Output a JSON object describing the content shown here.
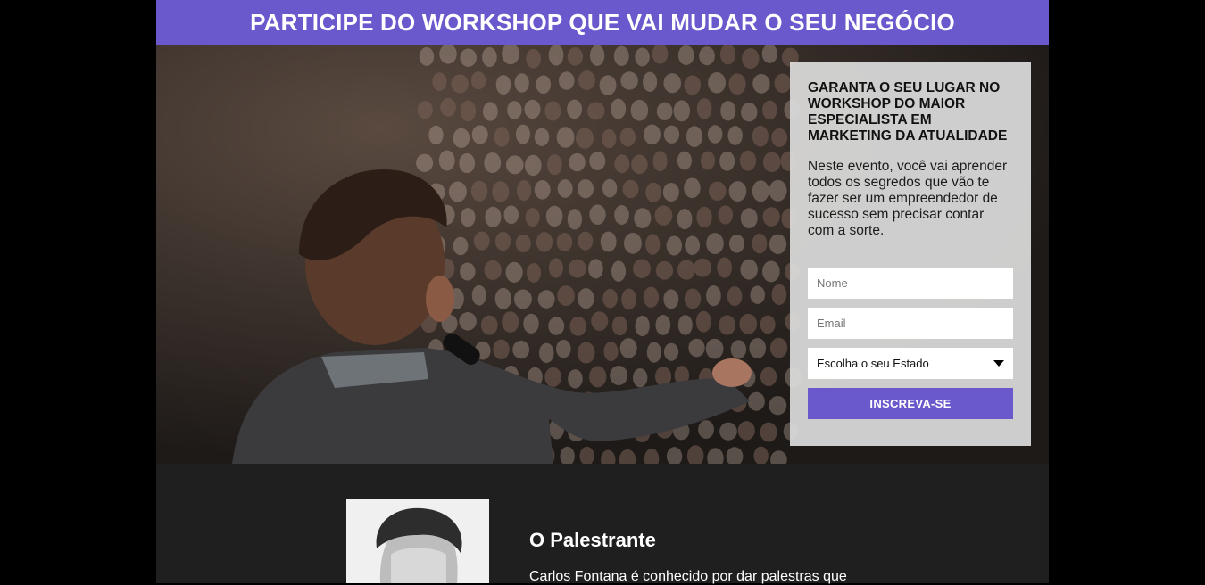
{
  "banner": {
    "title": "PARTICIPE DO WORKSHOP QUE VAI MUDAR O SEU NEGÓCIO"
  },
  "hero": {
    "image_subject": "speaker-with-microphone-facing-audience"
  },
  "form": {
    "title": "GARANTA O SEU LUGAR NO WORKSHOP DO MAIOR ESPECIALISTA EM MARKETING DA ATUALIDADE",
    "description": "Neste evento, você vai aprender todos os segredos que vão te fazer ser um empreendedor de sucesso sem precisar contar com a sorte.",
    "name_placeholder": "Nome",
    "email_placeholder": "Email",
    "state_select_value": "Escolha o seu Estado",
    "submit_label": "INSCREVA-SE"
  },
  "speaker": {
    "heading": "O Palestrante",
    "text": "Carlos Fontana é conhecido por dar palestras que"
  },
  "colors": {
    "accent": "#6a59cc",
    "page_background": "#000000",
    "section_background": "#1f1f1f",
    "card_background": "#dcdcdc"
  }
}
